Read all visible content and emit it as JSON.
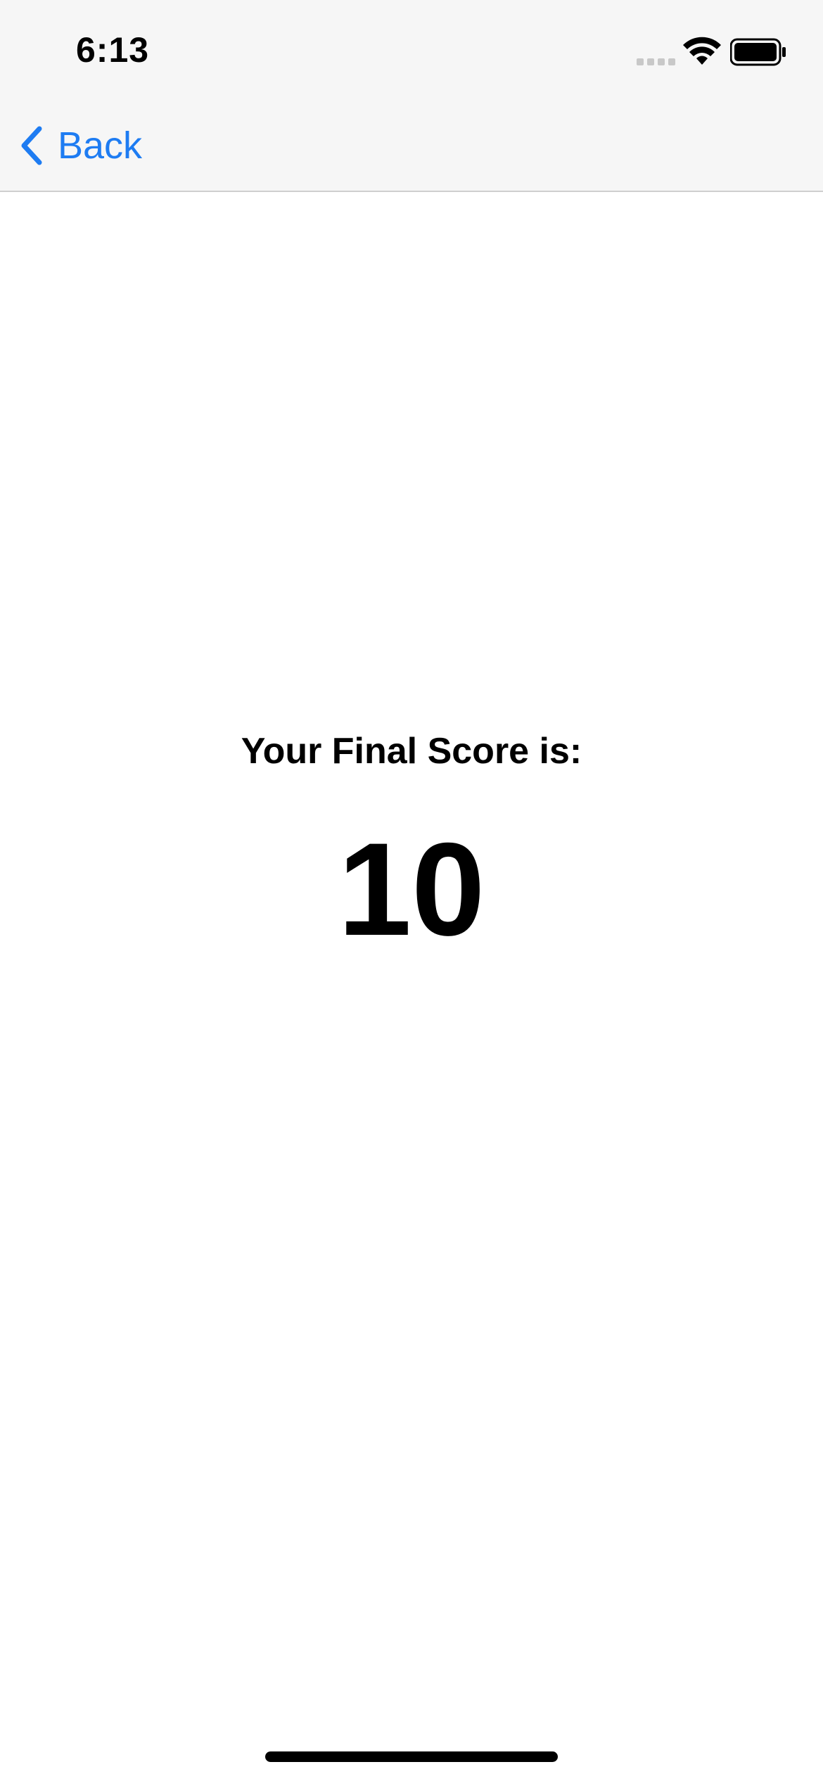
{
  "status_bar": {
    "time": "6:13",
    "icons": [
      "signal-icon",
      "wifi-icon",
      "battery-icon"
    ]
  },
  "nav": {
    "back_label": "Back",
    "accent_color": "#1e7cf2"
  },
  "main": {
    "score_title": "Your Final Score is:",
    "score_value": "10"
  }
}
